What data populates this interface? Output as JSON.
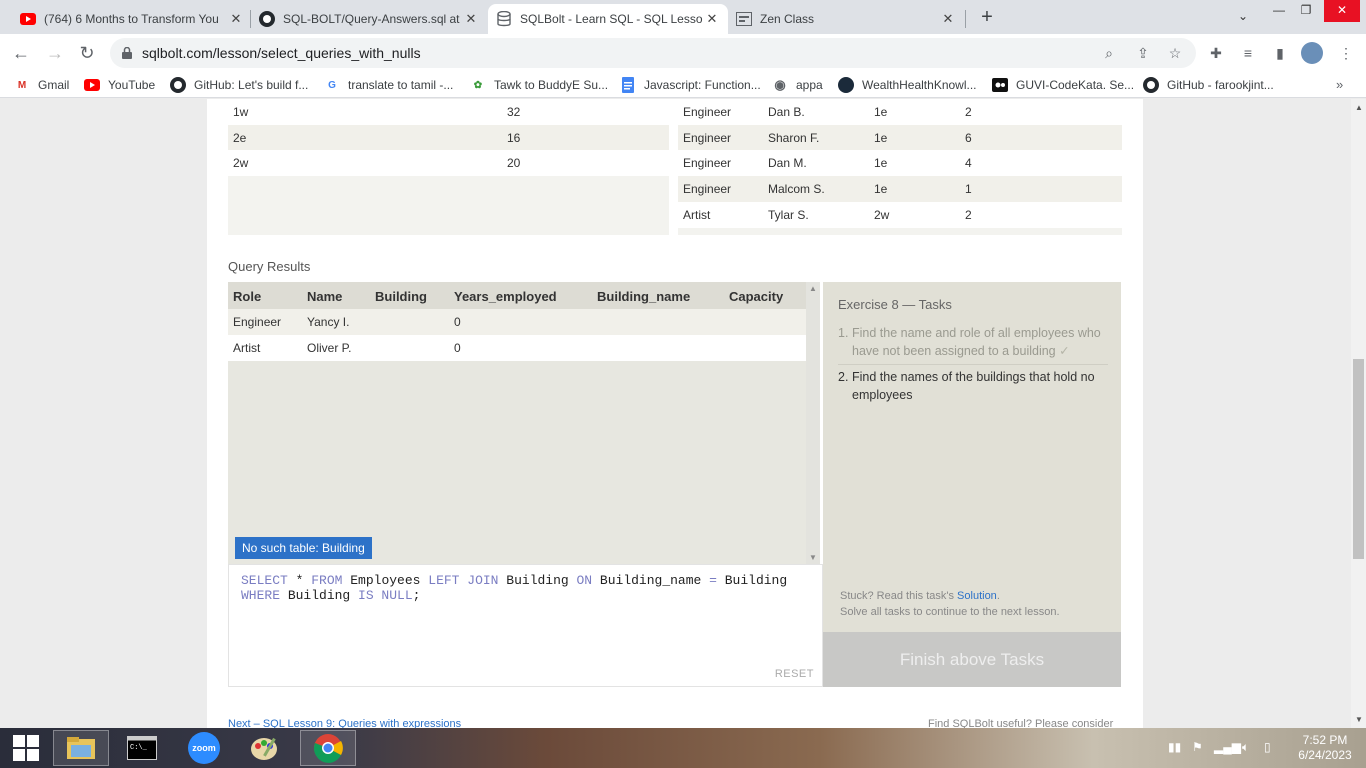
{
  "browser": {
    "tabs": [
      {
        "title": "(764) 6 Months to Transform You",
        "icon": "youtube-icon"
      },
      {
        "title": "SQL-BOLT/Query-Answers.sql at",
        "icon": "github-icon"
      },
      {
        "title": "SQLBolt - Learn SQL - SQL Lesso",
        "icon": "database-icon"
      },
      {
        "title": "Zen Class",
        "icon": "zen-icon"
      }
    ],
    "url": "sqlbolt.com/lesson/select_queries_with_nulls",
    "bookmarks": [
      "Gmail",
      "YouTube",
      "GitHub: Let's build f...",
      "translate to tamil -...",
      "Tawk to BuddyE Su...",
      "Javascript: Function...",
      "appa",
      "WealthHealthKnowl...",
      "GUVI-CodeKata. Se...",
      "GitHub - farookjint..."
    ],
    "more": "»"
  },
  "top_tables": {
    "buildings": [
      {
        "name": "1w",
        "capacity": "32"
      },
      {
        "name": "2e",
        "capacity": "16"
      },
      {
        "name": "2w",
        "capacity": "20"
      }
    ],
    "employees": [
      {
        "role": "Engineer",
        "name": "Dan B.",
        "building": "1e",
        "years": "2"
      },
      {
        "role": "Engineer",
        "name": "Sharon F.",
        "building": "1e",
        "years": "6"
      },
      {
        "role": "Engineer",
        "name": "Dan M.",
        "building": "1e",
        "years": "4"
      },
      {
        "role": "Engineer",
        "name": "Malcom S.",
        "building": "1e",
        "years": "1"
      },
      {
        "role": "Artist",
        "name": "Tylar S.",
        "building": "2w",
        "years": "2"
      }
    ]
  },
  "results": {
    "label": "Query Results",
    "headers": [
      "Role",
      "Name",
      "Building",
      "Years_employed",
      "Building_name",
      "Capacity"
    ],
    "rows": [
      [
        "Engineer",
        "Yancy I.",
        "",
        "0",
        "",
        ""
      ],
      [
        "Artist",
        "Oliver P.",
        "",
        "0",
        "",
        ""
      ]
    ],
    "error": "No such table: Building"
  },
  "editor": {
    "line1": [
      "SELECT",
      " * ",
      "FROM",
      " Employees ",
      "LEFT JOIN",
      " Building ",
      "ON",
      " Building_name ",
      "=",
      " Building"
    ],
    "line2": [
      "WHERE",
      " Building ",
      "IS NULL",
      ";"
    ],
    "reset": "RESET"
  },
  "tasks": {
    "title": "Exercise 8 — Tasks",
    "items": [
      {
        "num": "1.",
        "text": "Find the name and role of all employees who have not been assigned to a building",
        "check": "✓"
      },
      {
        "num": "2.",
        "text": "Find the names of the buildings that hold no employees"
      }
    ],
    "stuck_prefix": "Stuck? Read this task's ",
    "solution": "Solution",
    "stuck_suffix": ".",
    "continue": "Solve all tasks to continue to the next lesson.",
    "finish": "Finish above Tasks"
  },
  "footer_hint": {
    "left": "Next – SQL Lesson 9: Queries with expressions",
    "right": "Find SQLBolt useful? Please consider"
  },
  "taskbar": {
    "time": "7:52 PM",
    "date": "6/24/2023",
    "zoom": "zoom"
  }
}
